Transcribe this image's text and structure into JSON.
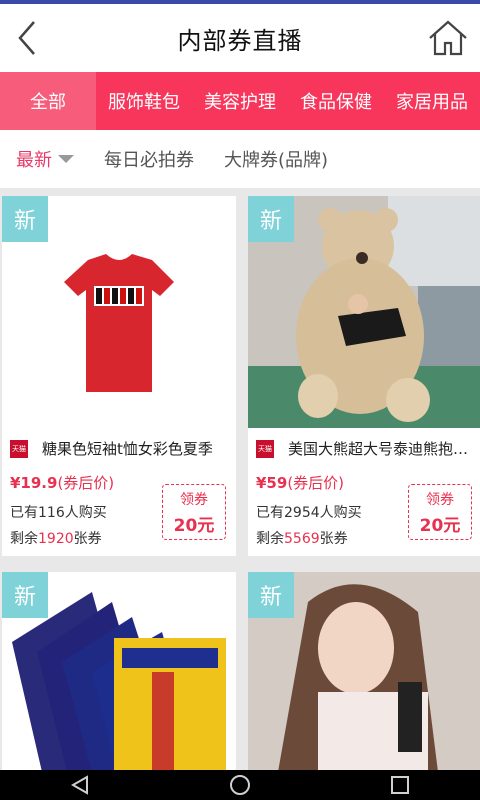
{
  "header": {
    "title": "内部券直播"
  },
  "categories": [
    "全部",
    "服饰鞋包",
    "美容护理",
    "食品保健",
    "家居用品"
  ],
  "filters": [
    "最新",
    "每日必拍券",
    "大牌券(品牌)"
  ],
  "badge_new": "新",
  "tmall_label": "天猫",
  "coupon_label": "领券",
  "products": [
    {
      "name": "糖果色短袖t恤女彩色夏季",
      "price": "¥19.9",
      "price_suffix": "(券后价)",
      "sold_prefix": "已有",
      "sold": "116",
      "sold_suffix": "人购买",
      "remain_prefix": "剩余",
      "remain": "1920",
      "remain_suffix": "张券",
      "coupon": "20元"
    },
    {
      "name": "美国大熊超大号泰迪熊抱抱熊",
      "price": "¥59",
      "price_suffix": "(券后价)",
      "sold_prefix": "已有",
      "sold": "2954",
      "sold_suffix": "人购买",
      "remain_prefix": "剩余",
      "remain": "5569",
      "remain_suffix": "张券",
      "coupon": "20元"
    }
  ],
  "colors": {
    "brand": "#f8355b",
    "accent": "#e8304f",
    "badge": "#7ed2d8"
  },
  "icons": {
    "back": "chevron-left-icon",
    "home": "home-icon",
    "nav_back": "triangle-back-icon",
    "nav_home": "circle-home-icon",
    "nav_recent": "square-recent-icon"
  }
}
